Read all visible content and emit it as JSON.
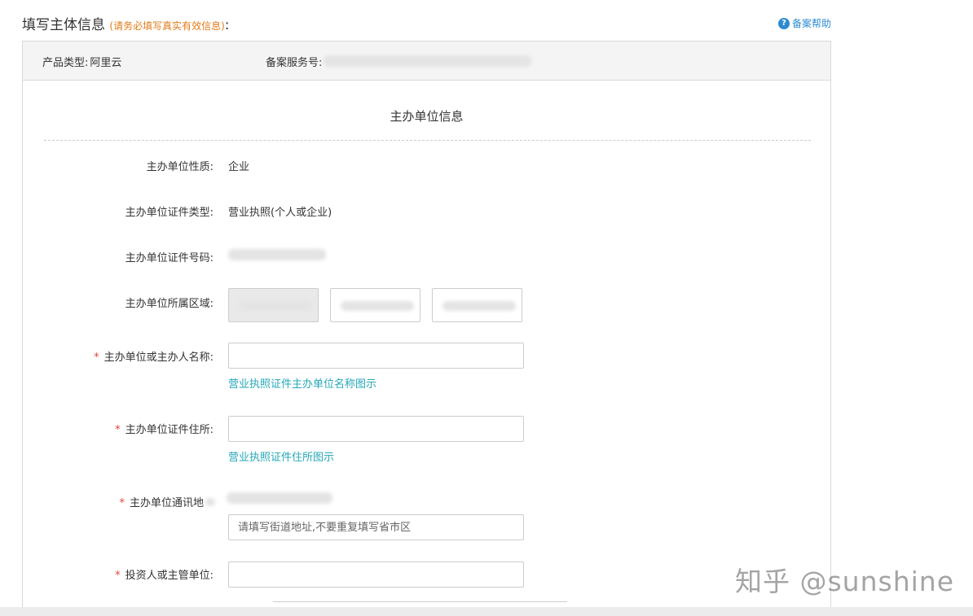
{
  "header": {
    "title": "填写主体信息",
    "hint": "(请务必填写真实有效信息)",
    "colon": ":",
    "help_label": "备案帮助",
    "help_icon": "question-circle-icon"
  },
  "product_bar": {
    "product_type_label": "产品类型:",
    "product_type_value": "阿里云",
    "service_no_label": "备案服务号:"
  },
  "form": {
    "section_title": "主办单位信息",
    "fields": {
      "nature_label": "主办单位性质:",
      "nature_value": "企业",
      "cert_type_label": "主办单位证件类型:",
      "cert_type_value": "营业执照(个人或企业)",
      "cert_no_label": "主办单位证件号码:",
      "region_label": "主办单位所属区域:",
      "name_label": "主办单位或主办人名称:",
      "name_example": "营业执照证件主办单位名称图示",
      "address_label": "主办单位证件住所:",
      "address_example": "营业执照证件住所图示",
      "mail_address_label": "主办单位通讯地",
      "mail_address_placeholder": "请填写街道地址,不要重复填写省市区",
      "investor_label": "投资人或主管单位:"
    },
    "required_mark": "*"
  },
  "watermark": "知乎 @sunshine"
}
